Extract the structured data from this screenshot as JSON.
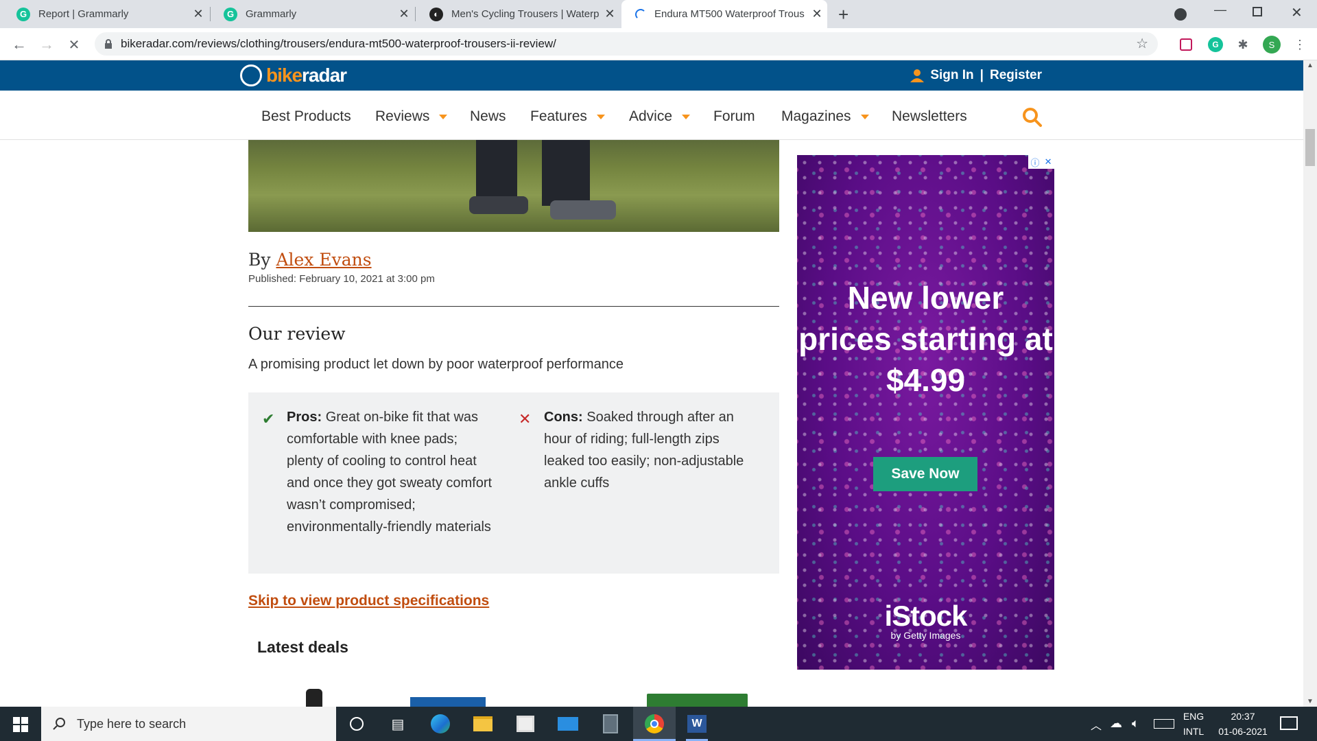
{
  "browser": {
    "tabs": [
      {
        "title": "Report | Grammarly",
        "active": false
      },
      {
        "title": "Grammarly",
        "active": false
      },
      {
        "title": "Men's Cycling Trousers | Waterpr",
        "active": false
      },
      {
        "title": "Endura MT500 Waterproof Trous",
        "active": true
      }
    ],
    "url": "bikeradar.com/reviews/clothing/trousers/endura-mt500-waterproof-trousers-ii-review/",
    "profile_initial": "S"
  },
  "site": {
    "brand_part1": "bike",
    "brand_part2": "radar",
    "sign_in": "Sign In",
    "separator": "|",
    "register": "Register",
    "nav": {
      "best_products": "Best Products",
      "reviews": "Reviews",
      "news": "News",
      "features": "Features",
      "advice": "Advice",
      "forum": "Forum",
      "magazines": "Magazines",
      "newsletters": "Newsletters"
    }
  },
  "article": {
    "by": "By",
    "author": "Alex Evans",
    "published": "Published: February 10, 2021 at 3:00 pm",
    "review_heading": "Our review",
    "review_summary": "A promising product let down by poor waterproof performance",
    "pros_label": "Pros:",
    "pros_text": "Great on-bike fit that was comfortable with knee pads; plenty of cooling to control heat and once they got sweaty comfort wasn’t compromised; environmentally-friendly materials",
    "cons_label": "Cons:",
    "cons_text": "Soaked through after an hour of riding; full-length zips leaked too easily; non-adjustable ankle cuffs",
    "skip_link": "Skip to view product specifications",
    "latest_deals": "Latest deals"
  },
  "ad": {
    "headline": "New lower prices starting at $4.99",
    "cta": "Save Now",
    "brand": "iStock",
    "brand_sub": "by Getty Images"
  },
  "taskbar": {
    "search_placeholder": "Type here to search",
    "lang_top": "ENG",
    "lang_bottom": "INTL",
    "time": "20:37",
    "date": "01-06-2021"
  },
  "colors": {
    "site_blue": "#02528a",
    "accent_orange": "#f7941d",
    "link_orange": "#c14d0f",
    "ad_purple": "#5a0d86",
    "ad_cta": "#1d9e7e"
  }
}
